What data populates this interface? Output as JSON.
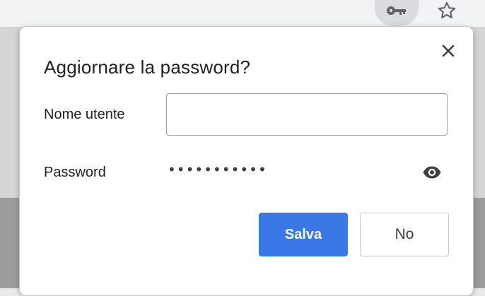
{
  "toolbar": {
    "key_icon": "key-icon",
    "star_icon": "star-icon"
  },
  "dialog": {
    "title": "Aggiornare la password?",
    "close_icon": "close-icon",
    "username_label": "Nome utente",
    "username_value": "",
    "password_label": "Password",
    "password_value": "•••••••••••",
    "eye_icon": "eye-icon",
    "save_label": "Salva",
    "no_label": "No"
  },
  "colors": {
    "primary_button": "#3b78e7",
    "text": "#202124"
  }
}
